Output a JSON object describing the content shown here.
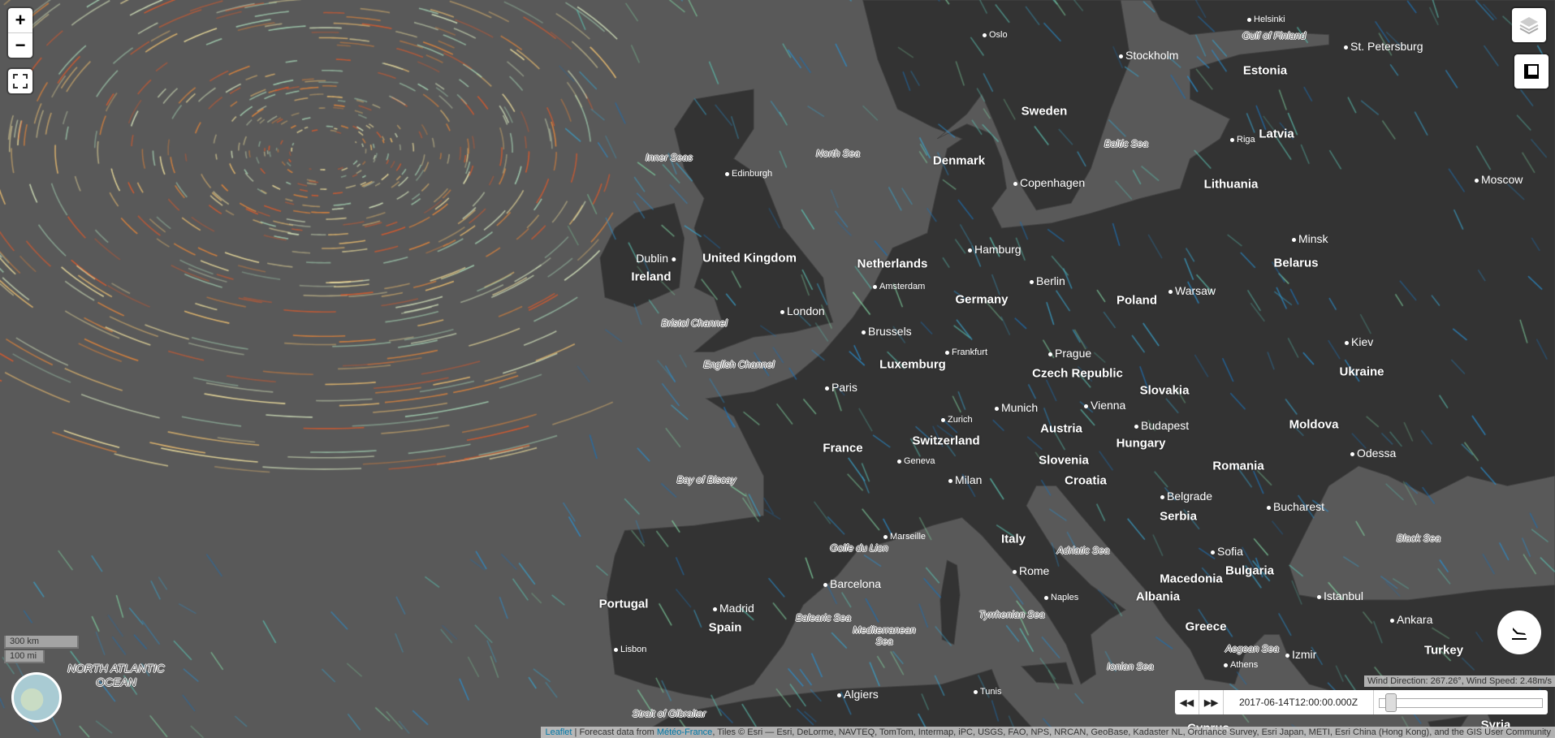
{
  "controls": {
    "zoom_in": "+",
    "zoom_out": "−",
    "fullscreen_icon": "fullscreen-icon",
    "layers_icon": "layers-icon",
    "ruler_icon": "ruler-icon",
    "plane_icon": "flight-land-icon"
  },
  "scale": {
    "metric": "300 km",
    "imperial": "100 mi"
  },
  "timeline": {
    "back_icon": "fast-rewind-icon",
    "forward_icon": "fast-forward-icon",
    "back": "◀◀",
    "forward": "▶▶",
    "current_time": "2017-06-14T12:00:00.000Z",
    "slider_position_percent": 4
  },
  "wind_info": "Wind Direction: 267.26°, Wind Speed: 2.48m/s",
  "attribution": {
    "leaflet": "Leaflet",
    "sep1": " | Forecast data from ",
    "meteo": "Météo-France",
    "tiles": ", Tiles © Esri — Esri, DeLorme, NAVTEQ, TomTom, Intermap, iPC, USGS, FAO, NPS, NRCAN, GeoBase, Kadaster NL, Ordnance Survey, Esri Japan, METI, Esri China (Hong Kong), and the GIS User Community"
  },
  "colors": {
    "sea": "#595959",
    "land": "#333333",
    "wind_warm": "#e8873a",
    "wind_cool": "#2a8fd0"
  },
  "map": {
    "countries": [
      "Sweden",
      "Estonia",
      "Latvia",
      "Lithuania",
      "Denmark",
      "Belarus",
      "Poland",
      "Germany",
      "Netherlands",
      "United Kingdom",
      "Ireland",
      "Luxemburg",
      "Czech Republic",
      "Slovakia",
      "Ukraine",
      "Moldova",
      "Austria",
      "Hungary",
      "Switzerland",
      "France",
      "Slovenia",
      "Croatia",
      "Romania",
      "Serbia",
      "Italy",
      "Bulgaria",
      "Macedonia",
      "Albania",
      "Portugal",
      "Spain",
      "Greece",
      "Turkey",
      "Cyprus",
      "Syria"
    ],
    "cities": [
      "Oslo",
      "Helsinki",
      "St. Petersburg",
      "Stockholm",
      "Riga",
      "Moscow",
      "Copenhagen",
      "Edinburgh",
      "Dublin",
      "Hamburg",
      "Minsk",
      "Berlin",
      "Warsaw",
      "Amsterdam",
      "London",
      "Brussels",
      "Frankfurt",
      "Prague",
      "Kiev",
      "Paris",
      "Munich",
      "Vienna",
      "Zurich",
      "Budapest",
      "Odessa",
      "Geneva",
      "Milan",
      "Belgrade",
      "Bucharest",
      "Marseille",
      "Sofia",
      "Rome",
      "Barcelona",
      "Naples",
      "Istanbul",
      "Ankara",
      "Madrid",
      "Izmir",
      "Lisbon",
      "Athens",
      "Algiers",
      "Tunis"
    ],
    "seas": [
      "Gulf of Finland",
      "Inner Seas",
      "North Sea",
      "Baltic Sea",
      "Bristol Channel",
      "English Channel",
      "Bay of Biscay",
      "Golfe du Lion",
      "Adriatic Sea",
      "Black Sea",
      "Balearic Sea",
      "Tyrrhenian Sea",
      "Mediterranean\nSea",
      "Ionian Sea",
      "Aegean Sea",
      "Strait of Gibraltar"
    ],
    "ocean": "NORTH ATLANTIC\nOCEAN"
  }
}
